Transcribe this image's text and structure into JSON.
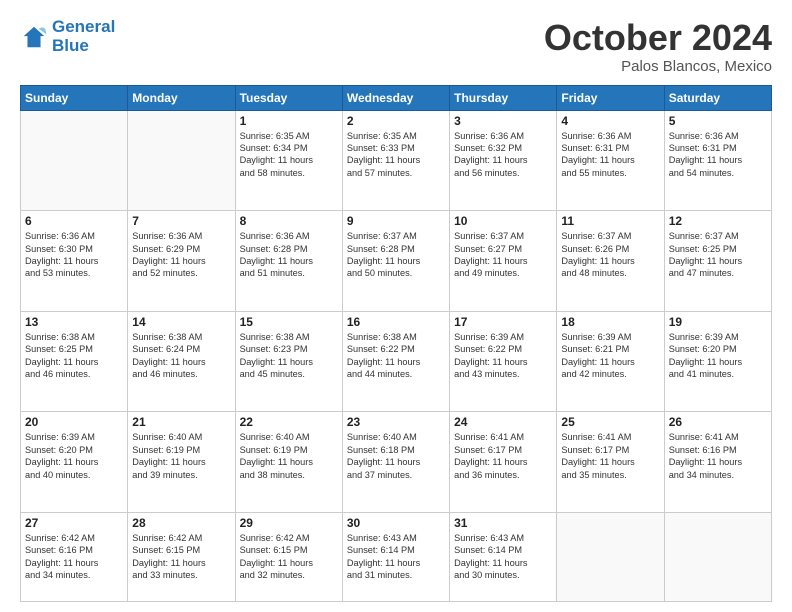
{
  "header": {
    "logo_line1": "General",
    "logo_line2": "Blue",
    "month": "October 2024",
    "location": "Palos Blancos, Mexico"
  },
  "weekdays": [
    "Sunday",
    "Monday",
    "Tuesday",
    "Wednesday",
    "Thursday",
    "Friday",
    "Saturday"
  ],
  "weeks": [
    [
      {
        "day": "",
        "content": ""
      },
      {
        "day": "",
        "content": ""
      },
      {
        "day": "1",
        "content": "Sunrise: 6:35 AM\nSunset: 6:34 PM\nDaylight: 11 hours\nand 58 minutes."
      },
      {
        "day": "2",
        "content": "Sunrise: 6:35 AM\nSunset: 6:33 PM\nDaylight: 11 hours\nand 57 minutes."
      },
      {
        "day": "3",
        "content": "Sunrise: 6:36 AM\nSunset: 6:32 PM\nDaylight: 11 hours\nand 56 minutes."
      },
      {
        "day": "4",
        "content": "Sunrise: 6:36 AM\nSunset: 6:31 PM\nDaylight: 11 hours\nand 55 minutes."
      },
      {
        "day": "5",
        "content": "Sunrise: 6:36 AM\nSunset: 6:31 PM\nDaylight: 11 hours\nand 54 minutes."
      }
    ],
    [
      {
        "day": "6",
        "content": "Sunrise: 6:36 AM\nSunset: 6:30 PM\nDaylight: 11 hours\nand 53 minutes."
      },
      {
        "day": "7",
        "content": "Sunrise: 6:36 AM\nSunset: 6:29 PM\nDaylight: 11 hours\nand 52 minutes."
      },
      {
        "day": "8",
        "content": "Sunrise: 6:36 AM\nSunset: 6:28 PM\nDaylight: 11 hours\nand 51 minutes."
      },
      {
        "day": "9",
        "content": "Sunrise: 6:37 AM\nSunset: 6:28 PM\nDaylight: 11 hours\nand 50 minutes."
      },
      {
        "day": "10",
        "content": "Sunrise: 6:37 AM\nSunset: 6:27 PM\nDaylight: 11 hours\nand 49 minutes."
      },
      {
        "day": "11",
        "content": "Sunrise: 6:37 AM\nSunset: 6:26 PM\nDaylight: 11 hours\nand 48 minutes."
      },
      {
        "day": "12",
        "content": "Sunrise: 6:37 AM\nSunset: 6:25 PM\nDaylight: 11 hours\nand 47 minutes."
      }
    ],
    [
      {
        "day": "13",
        "content": "Sunrise: 6:38 AM\nSunset: 6:25 PM\nDaylight: 11 hours\nand 46 minutes."
      },
      {
        "day": "14",
        "content": "Sunrise: 6:38 AM\nSunset: 6:24 PM\nDaylight: 11 hours\nand 46 minutes."
      },
      {
        "day": "15",
        "content": "Sunrise: 6:38 AM\nSunset: 6:23 PM\nDaylight: 11 hours\nand 45 minutes."
      },
      {
        "day": "16",
        "content": "Sunrise: 6:38 AM\nSunset: 6:22 PM\nDaylight: 11 hours\nand 44 minutes."
      },
      {
        "day": "17",
        "content": "Sunrise: 6:39 AM\nSunset: 6:22 PM\nDaylight: 11 hours\nand 43 minutes."
      },
      {
        "day": "18",
        "content": "Sunrise: 6:39 AM\nSunset: 6:21 PM\nDaylight: 11 hours\nand 42 minutes."
      },
      {
        "day": "19",
        "content": "Sunrise: 6:39 AM\nSunset: 6:20 PM\nDaylight: 11 hours\nand 41 minutes."
      }
    ],
    [
      {
        "day": "20",
        "content": "Sunrise: 6:39 AM\nSunset: 6:20 PM\nDaylight: 11 hours\nand 40 minutes."
      },
      {
        "day": "21",
        "content": "Sunrise: 6:40 AM\nSunset: 6:19 PM\nDaylight: 11 hours\nand 39 minutes."
      },
      {
        "day": "22",
        "content": "Sunrise: 6:40 AM\nSunset: 6:19 PM\nDaylight: 11 hours\nand 38 minutes."
      },
      {
        "day": "23",
        "content": "Sunrise: 6:40 AM\nSunset: 6:18 PM\nDaylight: 11 hours\nand 37 minutes."
      },
      {
        "day": "24",
        "content": "Sunrise: 6:41 AM\nSunset: 6:17 PM\nDaylight: 11 hours\nand 36 minutes."
      },
      {
        "day": "25",
        "content": "Sunrise: 6:41 AM\nSunset: 6:17 PM\nDaylight: 11 hours\nand 35 minutes."
      },
      {
        "day": "26",
        "content": "Sunrise: 6:41 AM\nSunset: 6:16 PM\nDaylight: 11 hours\nand 34 minutes."
      }
    ],
    [
      {
        "day": "27",
        "content": "Sunrise: 6:42 AM\nSunset: 6:16 PM\nDaylight: 11 hours\nand 34 minutes."
      },
      {
        "day": "28",
        "content": "Sunrise: 6:42 AM\nSunset: 6:15 PM\nDaylight: 11 hours\nand 33 minutes."
      },
      {
        "day": "29",
        "content": "Sunrise: 6:42 AM\nSunset: 6:15 PM\nDaylight: 11 hours\nand 32 minutes."
      },
      {
        "day": "30",
        "content": "Sunrise: 6:43 AM\nSunset: 6:14 PM\nDaylight: 11 hours\nand 31 minutes."
      },
      {
        "day": "31",
        "content": "Sunrise: 6:43 AM\nSunset: 6:14 PM\nDaylight: 11 hours\nand 30 minutes."
      },
      {
        "day": "",
        "content": ""
      },
      {
        "day": "",
        "content": ""
      }
    ]
  ]
}
